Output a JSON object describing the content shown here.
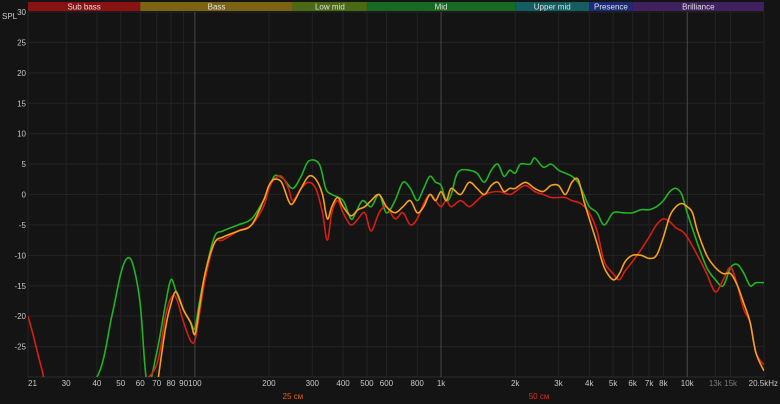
{
  "chart_data": {
    "type": "line",
    "ylabel": "SPL",
    "x_unit": "Hz",
    "x_scale": "log",
    "xlim": [
      21,
      20500
    ],
    "ylim": [
      -30,
      30
    ],
    "grid": true,
    "colors": {
      "background": "#141414",
      "grid_minor": "#232323",
      "grid_major": "#484848"
    },
    "bands": [
      {
        "label": "Sub bass",
        "from": 21,
        "to": 60,
        "color": "#8a1212"
      },
      {
        "label": "Bass",
        "from": 60,
        "to": 250,
        "color": "#7a6412"
      },
      {
        "label": "Low mid",
        "from": 250,
        "to": 500,
        "color": "#4a6a14"
      },
      {
        "label": "Mid",
        "from": 500,
        "to": 2000,
        "color": "#166a22"
      },
      {
        "label": "Upper mid",
        "from": 2000,
        "to": 4000,
        "color": "#125e60"
      },
      {
        "label": "Presence",
        "from": 4000,
        "to": 6000,
        "color": "#1a2c7a"
      },
      {
        "label": "Brilliance",
        "from": 6000,
        "to": 20500,
        "color": "#40205e"
      }
    ],
    "y_ticks": [
      {
        "v": 30,
        "label": "30"
      },
      {
        "v": 25,
        "label": "25"
      },
      {
        "v": 20,
        "label": "20"
      },
      {
        "v": 15,
        "label": "15"
      },
      {
        "v": 10,
        "label": "10"
      },
      {
        "v": 5,
        "label": "5"
      },
      {
        "v": 0,
        "label": "0"
      },
      {
        "v": -5,
        "label": "-5"
      },
      {
        "v": -10,
        "label": "-10"
      },
      {
        "v": -15,
        "label": "-15"
      },
      {
        "v": -20,
        "label": "-20"
      },
      {
        "v": -25,
        "label": "-25"
      }
    ],
    "x_ticks": [
      {
        "f": 21,
        "label": "21"
      },
      {
        "f": 30,
        "label": "30"
      },
      {
        "f": 40,
        "label": "40"
      },
      {
        "f": 50,
        "label": "50"
      },
      {
        "f": 60,
        "label": "60"
      },
      {
        "f": 70,
        "label": "70"
      },
      {
        "f": 80,
        "label": "80"
      },
      {
        "f": 90,
        "label": "90"
      },
      {
        "f": 100,
        "label": "100"
      },
      {
        "f": 200,
        "label": "200"
      },
      {
        "f": 300,
        "label": "300"
      },
      {
        "f": 400,
        "label": "400"
      },
      {
        "f": 500,
        "label": "500"
      },
      {
        "f": 600,
        "label": "600"
      },
      {
        "f": 800,
        "label": "800"
      },
      {
        "f": 1000,
        "label": "1k"
      },
      {
        "f": 2000,
        "label": "2k"
      },
      {
        "f": 3000,
        "label": "3k"
      },
      {
        "f": 4000,
        "label": "4k"
      },
      {
        "f": 5000,
        "label": "5k"
      },
      {
        "f": 6000,
        "label": "6k"
      },
      {
        "f": 7000,
        "label": "7k"
      },
      {
        "f": 8000,
        "label": "8k"
      },
      {
        "f": 10000,
        "label": "10k"
      },
      {
        "f": 13000,
        "label": "13k",
        "dim": true
      },
      {
        "f": 15000,
        "label": "15k",
        "dim": true
      },
      {
        "f": 20500,
        "label": "20.5kHz"
      }
    ],
    "major_gridlines_hz": [
      100,
      1000,
      10000
    ],
    "markers": [
      {
        "f": 250,
        "label": "25 см",
        "color": "#e0601a"
      },
      {
        "f": 2500,
        "label": "50 см",
        "color": "#e02a1a"
      }
    ],
    "series": [
      {
        "color": "#22b422",
        "points": [
          [
            30,
            -32
          ],
          [
            40,
            -30
          ],
          [
            46,
            -20
          ],
          [
            50,
            -13
          ],
          [
            53,
            -10.5
          ],
          [
            56,
            -11.5
          ],
          [
            60,
            -18
          ],
          [
            64,
            -31
          ],
          [
            70,
            -26
          ],
          [
            76,
            -18
          ],
          [
            80,
            -14
          ],
          [
            84,
            -16
          ],
          [
            90,
            -19
          ],
          [
            96,
            -21
          ],
          [
            100,
            -22
          ],
          [
            104,
            -18
          ],
          [
            110,
            -13
          ],
          [
            120,
            -7
          ],
          [
            130,
            -6
          ],
          [
            150,
            -5
          ],
          [
            170,
            -4
          ],
          [
            190,
            -1
          ],
          [
            200,
            1
          ],
          [
            210,
            3
          ],
          [
            220,
            3
          ],
          [
            230,
            2.5
          ],
          [
            250,
            1
          ],
          [
            270,
            3
          ],
          [
            290,
            5.5
          ],
          [
            320,
            5
          ],
          [
            340,
            1
          ],
          [
            360,
            0
          ],
          [
            400,
            -1
          ],
          [
            430,
            -4
          ],
          [
            450,
            -3
          ],
          [
            480,
            -1
          ],
          [
            520,
            -2
          ],
          [
            560,
            0
          ],
          [
            600,
            -3
          ],
          [
            650,
            -1
          ],
          [
            700,
            2
          ],
          [
            750,
            1
          ],
          [
            800,
            -1
          ],
          [
            850,
            1
          ],
          [
            900,
            3
          ],
          [
            950,
            2
          ],
          [
            1000,
            1.5
          ],
          [
            1050,
            -1
          ],
          [
            1100,
            0
          ],
          [
            1150,
            3
          ],
          [
            1200,
            4
          ],
          [
            1300,
            4
          ],
          [
            1400,
            3.5
          ],
          [
            1500,
            2
          ],
          [
            1600,
            4
          ],
          [
            1700,
            5
          ],
          [
            1800,
            3
          ],
          [
            1900,
            4
          ],
          [
            2000,
            3.5
          ],
          [
            2100,
            5
          ],
          [
            2300,
            5
          ],
          [
            2400,
            6
          ],
          [
            2600,
            4.5
          ],
          [
            2800,
            5
          ],
          [
            3000,
            4
          ],
          [
            3200,
            3.5
          ],
          [
            3400,
            3
          ],
          [
            3600,
            2
          ],
          [
            3800,
            0
          ],
          [
            4000,
            -2
          ],
          [
            4300,
            -3
          ],
          [
            4600,
            -5
          ],
          [
            5000,
            -3
          ],
          [
            5500,
            -3
          ],
          [
            6000,
            -3
          ],
          [
            6500,
            -2.5
          ],
          [
            7000,
            -2.5
          ],
          [
            7500,
            -2
          ],
          [
            8000,
            -1
          ],
          [
            8500,
            0.5
          ],
          [
            9000,
            1
          ],
          [
            9500,
            0
          ],
          [
            10000,
            -3
          ],
          [
            11000,
            -8
          ],
          [
            12000,
            -12
          ],
          [
            13000,
            -14
          ],
          [
            14000,
            -15
          ],
          [
            15000,
            -12
          ],
          [
            16000,
            -11.5
          ],
          [
            17000,
            -13
          ],
          [
            18000,
            -15
          ],
          [
            19000,
            -14.5
          ],
          [
            20500,
            -14.5
          ]
        ]
      },
      {
        "color": "#d81e14",
        "points": [
          [
            21,
            -20
          ],
          [
            22,
            -23
          ],
          [
            24,
            -29
          ],
          [
            26,
            -33
          ],
          [
            40,
            -33
          ],
          [
            50,
            -32
          ],
          [
            60,
            -31
          ],
          [
            70,
            -28
          ],
          [
            76,
            -20
          ],
          [
            80,
            -17
          ],
          [
            84,
            -17
          ],
          [
            90,
            -21
          ],
          [
            96,
            -24
          ],
          [
            100,
            -24
          ],
          [
            104,
            -20
          ],
          [
            110,
            -14
          ],
          [
            120,
            -8
          ],
          [
            130,
            -7.5
          ],
          [
            150,
            -6
          ],
          [
            170,
            -5
          ],
          [
            190,
            -2
          ],
          [
            200,
            1
          ],
          [
            210,
            2.5
          ],
          [
            225,
            3
          ],
          [
            240,
            1
          ],
          [
            250,
            -1
          ],
          [
            270,
            1
          ],
          [
            290,
            2
          ],
          [
            310,
            1
          ],
          [
            330,
            -3
          ],
          [
            345,
            -7.5
          ],
          [
            360,
            -3
          ],
          [
            380,
            -1
          ],
          [
            400,
            -3
          ],
          [
            430,
            -5
          ],
          [
            460,
            -4
          ],
          [
            490,
            -3
          ],
          [
            520,
            -6
          ],
          [
            560,
            -3
          ],
          [
            600,
            -2
          ],
          [
            650,
            -4
          ],
          [
            700,
            -3
          ],
          [
            750,
            -5
          ],
          [
            800,
            -4
          ],
          [
            850,
            -1.5
          ],
          [
            900,
            0
          ],
          [
            950,
            -1
          ],
          [
            1000,
            -2
          ],
          [
            1050,
            -1
          ],
          [
            1100,
            -2
          ],
          [
            1200,
            -1
          ],
          [
            1300,
            -2
          ],
          [
            1400,
            -1
          ],
          [
            1500,
            0
          ],
          [
            1700,
            0.5
          ],
          [
            1900,
            0
          ],
          [
            2000,
            0.5
          ],
          [
            2200,
            1.5
          ],
          [
            2400,
            0.5
          ],
          [
            2600,
            0
          ],
          [
            2800,
            -0.5
          ],
          [
            3000,
            -0.5
          ],
          [
            3200,
            -0.5
          ],
          [
            3400,
            -1
          ],
          [
            3700,
            -1.5
          ],
          [
            4000,
            -3
          ],
          [
            4300,
            -6
          ],
          [
            4600,
            -11
          ],
          [
            5000,
            -13
          ],
          [
            5300,
            -14
          ],
          [
            5600,
            -12.5
          ],
          [
            6000,
            -11
          ],
          [
            6500,
            -9
          ],
          [
            7000,
            -7
          ],
          [
            7500,
            -5
          ],
          [
            8000,
            -4
          ],
          [
            8500,
            -4.5
          ],
          [
            9000,
            -5.5
          ],
          [
            9500,
            -6
          ],
          [
            10000,
            -7
          ],
          [
            11000,
            -10
          ],
          [
            12000,
            -13
          ],
          [
            13000,
            -16
          ],
          [
            14000,
            -14
          ],
          [
            15000,
            -12
          ],
          [
            16000,
            -15
          ],
          [
            17000,
            -19
          ],
          [
            18000,
            -21
          ],
          [
            19000,
            -26
          ],
          [
            20500,
            -28
          ]
        ]
      },
      {
        "color": "#f5a020",
        "points": [
          [
            70,
            -32
          ],
          [
            76,
            -22
          ],
          [
            80,
            -18
          ],
          [
            84,
            -16
          ],
          [
            90,
            -19
          ],
          [
            96,
            -21
          ],
          [
            100,
            -23
          ],
          [
            104,
            -19
          ],
          [
            110,
            -13
          ],
          [
            120,
            -8
          ],
          [
            130,
            -7
          ],
          [
            150,
            -6
          ],
          [
            170,
            -5
          ],
          [
            190,
            -1
          ],
          [
            200,
            1.5
          ],
          [
            210,
            2.5
          ],
          [
            225,
            2
          ],
          [
            240,
            -1
          ],
          [
            250,
            -1.5
          ],
          [
            270,
            1
          ],
          [
            290,
            3
          ],
          [
            310,
            2.5
          ],
          [
            330,
            0
          ],
          [
            345,
            -4
          ],
          [
            360,
            -2
          ],
          [
            380,
            -0.5
          ],
          [
            400,
            -2
          ],
          [
            430,
            -3.5
          ],
          [
            460,
            -2.5
          ],
          [
            490,
            -2
          ],
          [
            520,
            -1
          ],
          [
            560,
            0
          ],
          [
            600,
            -2
          ],
          [
            650,
            -3
          ],
          [
            700,
            -2
          ],
          [
            750,
            -1
          ],
          [
            800,
            -3
          ],
          [
            850,
            -2
          ],
          [
            900,
            0
          ],
          [
            950,
            -1
          ],
          [
            1000,
            0.5
          ],
          [
            1050,
            -1
          ],
          [
            1100,
            1
          ],
          [
            1200,
            0
          ],
          [
            1300,
            2
          ],
          [
            1400,
            1
          ],
          [
            1500,
            0
          ],
          [
            1600,
            1.5
          ],
          [
            1700,
            2
          ],
          [
            1800,
            0.5
          ],
          [
            1900,
            1
          ],
          [
            2000,
            1
          ],
          [
            2200,
            2
          ],
          [
            2400,
            1
          ],
          [
            2600,
            0.5
          ],
          [
            2800,
            1.5
          ],
          [
            3000,
            1.5
          ],
          [
            3200,
            0
          ],
          [
            3400,
            2
          ],
          [
            3600,
            2.5
          ],
          [
            3800,
            -1
          ],
          [
            4000,
            -4
          ],
          [
            4300,
            -8
          ],
          [
            4600,
            -12
          ],
          [
            5000,
            -14
          ],
          [
            5300,
            -13
          ],
          [
            5600,
            -11
          ],
          [
            6000,
            -10
          ],
          [
            6500,
            -10
          ],
          [
            7000,
            -10.5
          ],
          [
            7500,
            -10
          ],
          [
            8000,
            -7
          ],
          [
            8500,
            -3.5
          ],
          [
            9000,
            -2
          ],
          [
            9500,
            -1.5
          ],
          [
            10000,
            -2
          ],
          [
            10500,
            -3
          ],
          [
            11000,
            -6
          ],
          [
            12000,
            -10
          ],
          [
            13000,
            -12
          ],
          [
            14000,
            -13
          ],
          [
            15000,
            -13
          ],
          [
            16000,
            -15
          ],
          [
            17000,
            -18
          ],
          [
            18000,
            -21
          ],
          [
            19000,
            -26
          ],
          [
            20500,
            -29
          ]
        ]
      }
    ]
  }
}
